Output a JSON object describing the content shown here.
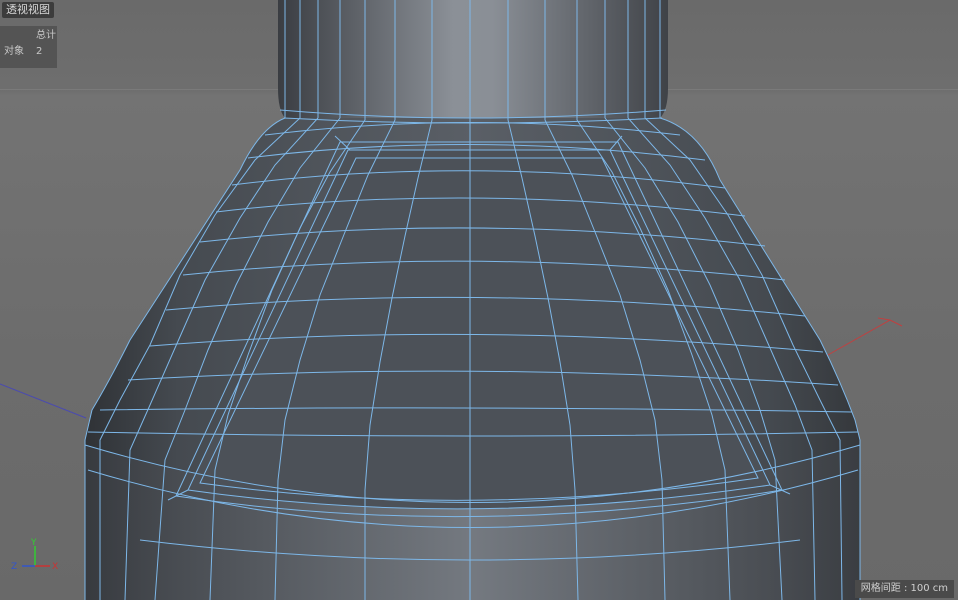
{
  "viewport": {
    "title": "透视视图",
    "stats": {
      "header": "总计",
      "row_label": "对象",
      "row_value": "2"
    },
    "grid_spacing": "网格间距 : 100 cm",
    "axis_labels": {
      "x": "X",
      "y": "Y",
      "z": "Z"
    }
  },
  "colors": {
    "background": "#6b6b6b",
    "wireframe": "#7db7e8",
    "mesh_shade": "#4a4f55",
    "x_axis": "#cc3333",
    "y_axis": "#33cc33",
    "z_axis": "#3355cc"
  },
  "scene": {
    "object_count": 2,
    "mesh": "lathed bottle shape with inset panel"
  }
}
